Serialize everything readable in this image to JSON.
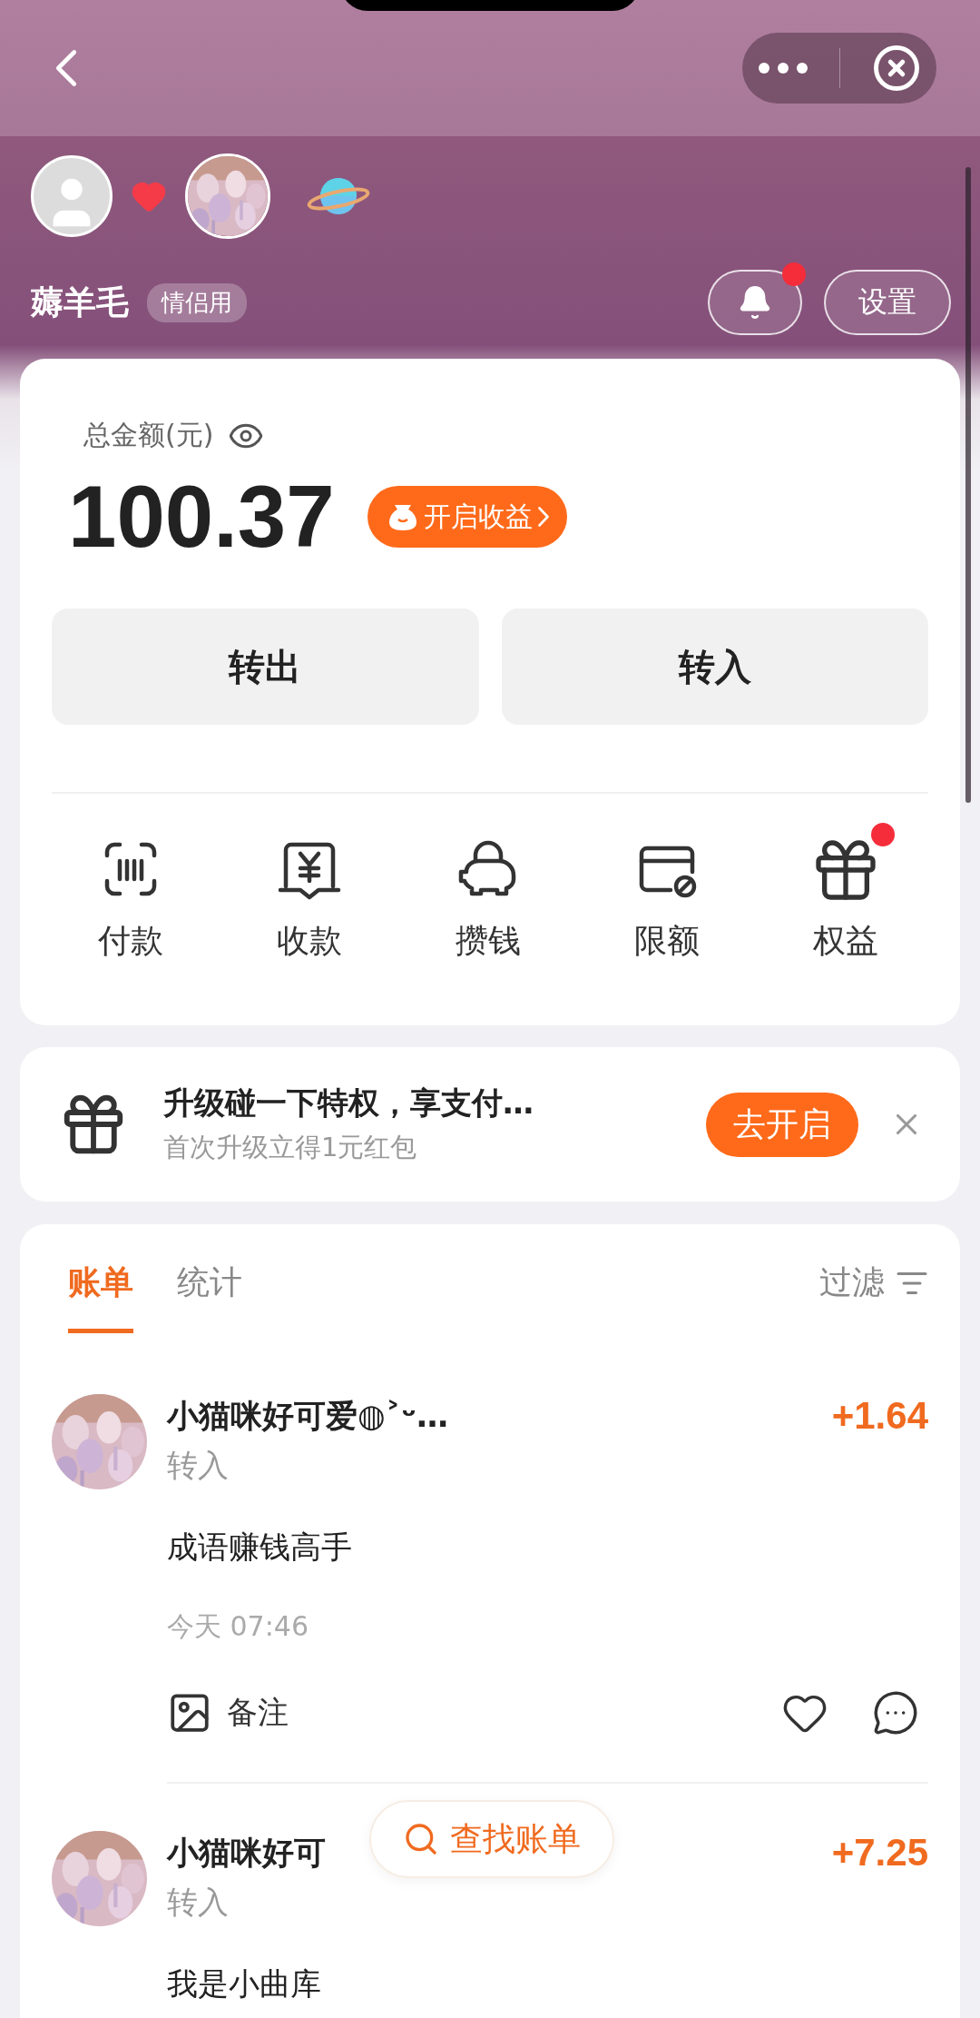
{
  "header": {
    "user_name": "薅羊毛",
    "tag": "情侣用",
    "has_notification": true,
    "settings": "设置"
  },
  "balance": {
    "label": "总金额(元)",
    "amount": "100.37",
    "earnings_button": "开启收益"
  },
  "transfer_buttons": [
    "转出",
    "转入"
  ],
  "quick_actions": [
    {
      "kind": "pay",
      "label": "付款",
      "badge": false
    },
    {
      "kind": "receive",
      "label": "收款",
      "badge": false
    },
    {
      "kind": "save",
      "label": "攒钱",
      "badge": false
    },
    {
      "kind": "limit",
      "label": "限额",
      "badge": false
    },
    {
      "kind": "benefits",
      "label": "权益",
      "badge": true
    }
  ],
  "promo": {
    "title": "升级碰一下特权，享支付…",
    "subtitle": "首次升级立得1元红包",
    "button": "去开启"
  },
  "bills": {
    "tabs": [
      {
        "label": "账单",
        "selected": true
      },
      {
        "label": "统计",
        "selected": false
      }
    ],
    "filter": "过滤",
    "items": [
      {
        "name": "小猫咪好可爱◍˃ᵕ…",
        "type": "转入",
        "amount": "+1.64",
        "note": "成语赚钱高手",
        "time": "今天 07:46",
        "remark": "备注"
      },
      {
        "name": "小猫咪好可",
        "type": "转入",
        "amount": "+7.25",
        "note": "我是小曲库"
      }
    ]
  },
  "search_button": "查找账单"
}
